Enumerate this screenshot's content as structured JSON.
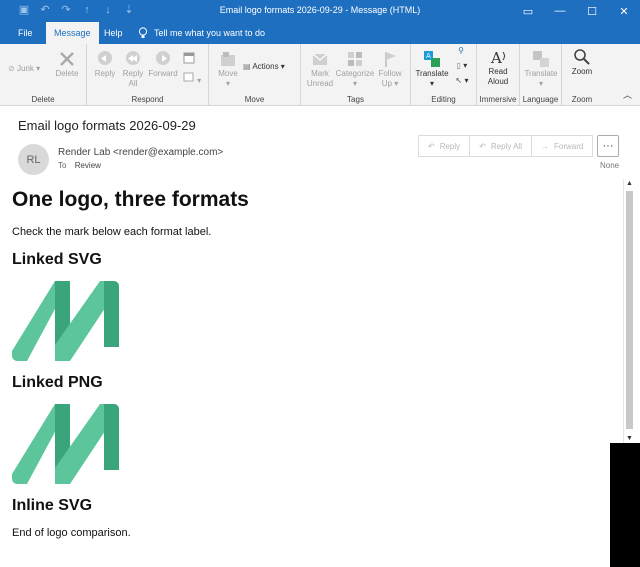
{
  "window": {
    "title": "Email logo formats 2026-09-29  -  Message (HTML)"
  },
  "menu": {
    "tabs": [
      "File",
      "Message",
      "Help"
    ],
    "tell_me": "Tell me what you want to do"
  },
  "ribbon": {
    "groups": {
      "delete": "Delete",
      "respond": "Respond",
      "move": "Move",
      "tags": "Tags",
      "editing": "Editing",
      "immersive": "Immersive",
      "language": "Language",
      "zoom": "Zoom"
    },
    "buttons": {
      "junk": "Junk",
      "delete": "Delete",
      "reply_1": "Reply",
      "reply_all_1": "Reply",
      "reply_all_2": "All",
      "forward": "Forward",
      "move": "Move",
      "actions": "Actions",
      "mark_unread_1": "Mark",
      "mark_unread_2": "Unread",
      "categorize": "Categorize",
      "follow_up_1": "Follow",
      "follow_up_2": "Up",
      "translate": "Translate",
      "read_aloud_1": "Read",
      "read_aloud_2": "Aloud",
      "translate_lang": "Translate",
      "zoom": "Zoom"
    }
  },
  "message": {
    "subject": "Email logo formats 2026-09-29",
    "avatar_initials": "RL",
    "sender": "Render Lab <render@example.com>",
    "to_label": "To",
    "to_value": "Review",
    "actions": {
      "reply": "Reply",
      "reply_all": "Reply All",
      "forward": "Forward"
    },
    "more": "···",
    "category": "None"
  },
  "content": {
    "heading": "One logo, three formats",
    "intro": "Check the mark below each format label.",
    "section_1": "Linked SVG",
    "section_2": "Linked PNG",
    "section_3": "Inline SVG",
    "outro": "End of logo comparison."
  },
  "colors": {
    "titlebar": "#1e6fc0",
    "logo_light": "#5cc59b",
    "logo_dark": "#3aa57a"
  }
}
